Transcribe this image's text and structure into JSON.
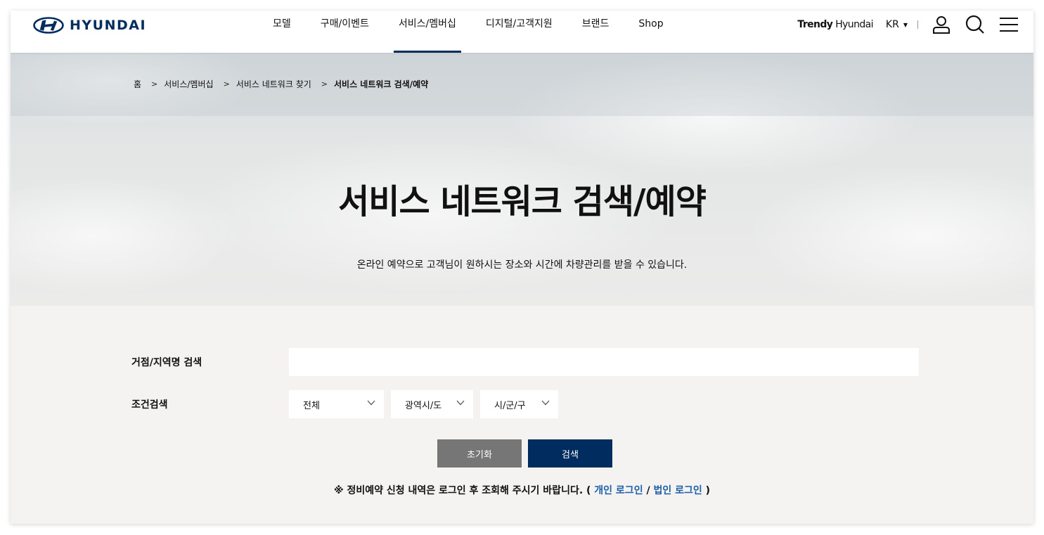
{
  "header": {
    "brand": "HYUNDAI",
    "nav": [
      {
        "label": "모델",
        "active": false
      },
      {
        "label": "구매/이벤트",
        "active": false
      },
      {
        "label": "서비스/멤버십",
        "active": true
      },
      {
        "label": "디지털/고객지원",
        "active": false
      },
      {
        "label": "브랜드",
        "active": false
      },
      {
        "label": "Shop",
        "active": false
      }
    ],
    "trendy_bold": "Trendy",
    "trendy_rest": " Hyundai",
    "lang": "KR",
    "icons": [
      "user-icon",
      "search-icon",
      "menu-icon"
    ]
  },
  "breadcrumb": [
    "홈",
    "서비스/멤버십",
    "서비스 네트워크 찾기",
    "서비스 네트워크 검색/예약"
  ],
  "hero": {
    "title": "서비스 네트워크 검색/예약",
    "subtitle": "온라인 예약으로 고객님이 원하시는 장소와 시간에 차량관리를 받을 수 있습니다."
  },
  "form": {
    "keyword_label": "거점/지역명 검색",
    "keyword_value": "",
    "condition_label": "조건검색",
    "selects": [
      "전체",
      "광역시/도",
      "시/군/구"
    ],
    "reset_label": "초기화",
    "search_label": "검색"
  },
  "notice": {
    "text": "※ 정비예약 신청 내역은 로그인 후 조회해 주시기 바랍니다. (",
    "personal_login": "개인 로그인",
    "slash": "/",
    "corporate_login": "법인 로그인",
    "close": ")"
  },
  "colors": {
    "brand_navy": "#002c5f",
    "search_button": "#002c5f",
    "reset_button": "#767676",
    "link": "#1a5fa8"
  }
}
